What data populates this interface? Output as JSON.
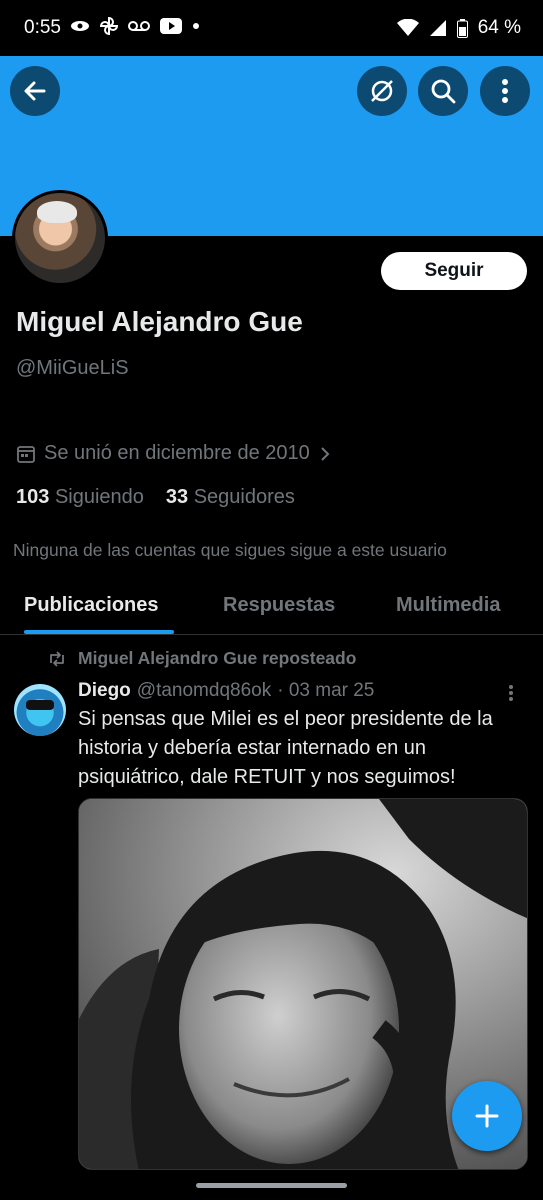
{
  "status_bar": {
    "time": "0:55",
    "battery": "64 %"
  },
  "header": {
    "back_icon": "arrow-left-icon",
    "translate_icon": "translate-off-icon",
    "search_icon": "search-icon",
    "more_icon": "vertical-dots-icon",
    "banner_color": "#1d9bf0"
  },
  "profile": {
    "follow_label": "Seguir",
    "display_name": "Miguel Alejandro Gue",
    "handle": "@MiiGueLiS",
    "joined": "Se unió en diciembre de 2010",
    "following_count": "103",
    "following_label": "Siguiendo",
    "followers_count": "33",
    "followers_label": "Seguidores",
    "mutual_note": "Ninguna de las cuentas que sigues sigue a este usuario"
  },
  "tabs": [
    {
      "label": "Publicaciones",
      "active": true
    },
    {
      "label": "Respuestas",
      "active": false
    },
    {
      "label": "Multimedia",
      "active": false
    }
  ],
  "post": {
    "repost_label": "Miguel Alejandro Gue reposteado",
    "author": "Diego",
    "author_handle": "@tanomdq86ok",
    "date": "· 03 mar 25",
    "text": "Si pensas que Milei es el peor presidente de la historia y debería estar internado en un psiquiátrico, dale RETUIT y nos seguimos!"
  },
  "colors": {
    "accent": "#1d9bf0",
    "background": "#000000",
    "secondary_text": "#71767b"
  }
}
